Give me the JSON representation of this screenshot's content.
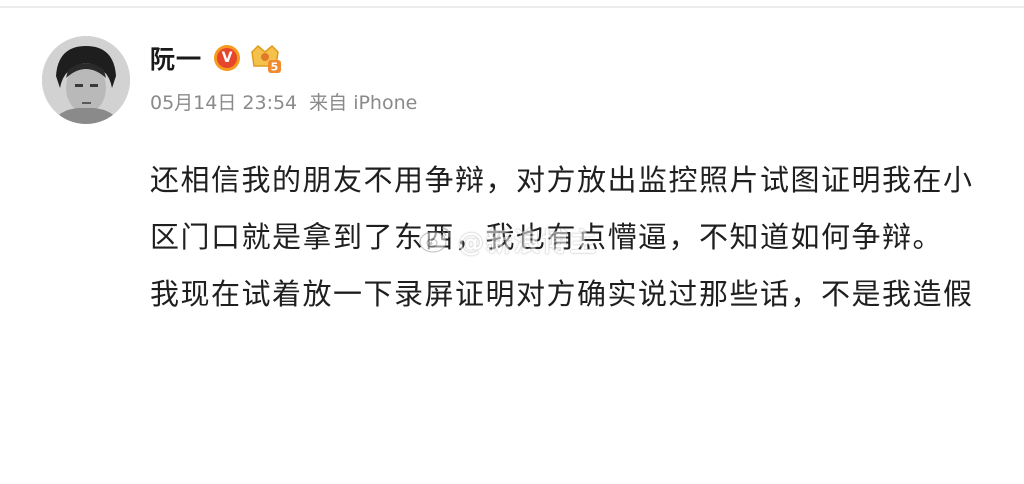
{
  "post": {
    "username": "阮一",
    "verified_badge": "V",
    "level_badge": "5",
    "date": "05月14日 23:54",
    "source": "来自 iPhone",
    "paragraphs": [
      "还相信我的朋友不用争辩，对方放出监控照片试图证明我在小区门口就是拿到了东西，我也有点懵逼，不知道如何争辩。",
      "我现在试着放一下录屏证明对方确实说过那些话，不是我造假"
    ]
  },
  "watermark": {
    "text": "@新浪博主"
  },
  "colors": {
    "verified_outer": "#f59a1d",
    "verified_inner": "#e6462c",
    "meta_text": "#8a8a8a",
    "body_text": "#1f1f1f"
  },
  "icons": {
    "verified": "verified-v-icon",
    "level": "level-crown-icon",
    "watermark": "weibo-logo-icon"
  }
}
